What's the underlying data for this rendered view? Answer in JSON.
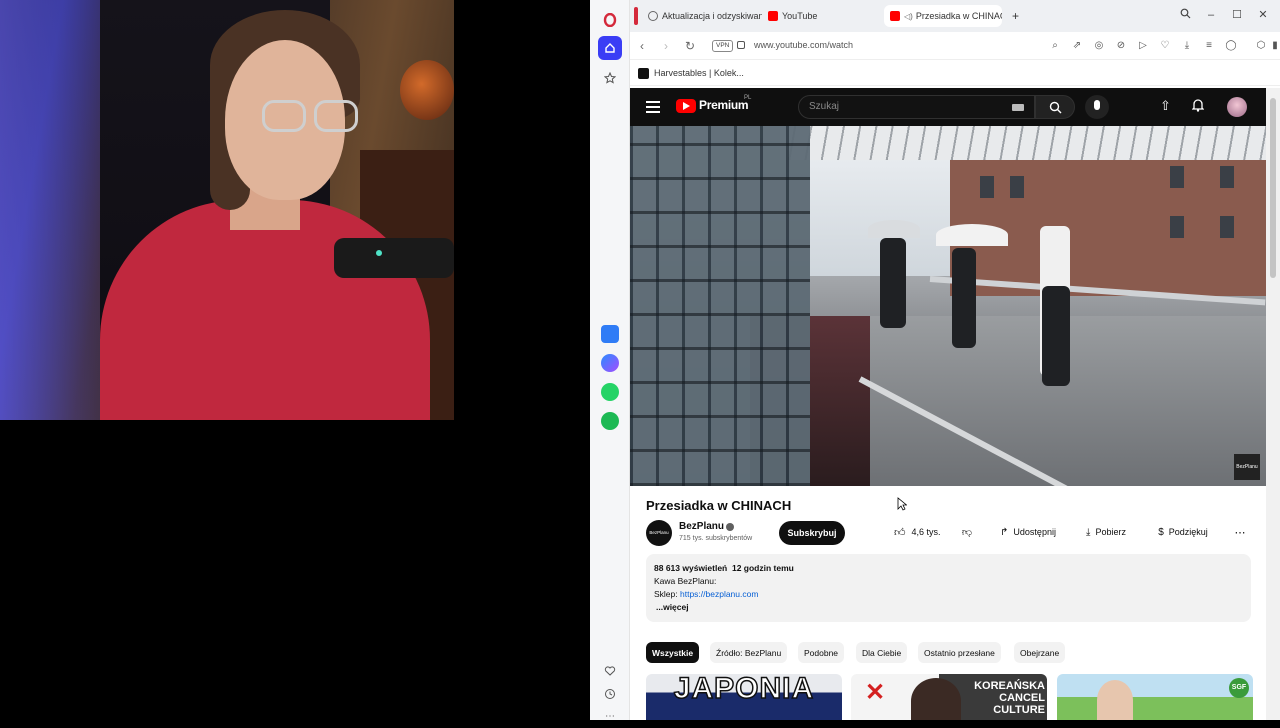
{
  "browser": {
    "tabs": [
      {
        "label": "Aktualizacja i odzyskiwanie",
        "favicon": "opera-update-icon"
      },
      {
        "label": "YouTube",
        "favicon": "youtube-icon"
      },
      {
        "label": "Przesiadka w CHINACH",
        "favicon": "youtube-icon"
      }
    ],
    "new_tab_label": "+",
    "address": "www.youtube.com/watch",
    "vpn_label": "VPN",
    "bookmark": "Harvestables | Kolek..."
  },
  "youtube": {
    "logo_text": "Premium",
    "premium_region": "PL",
    "search_placeholder": "Szukaj",
    "video_watermark": "BezPlanu",
    "title": "Przesiadka w CHINACH",
    "channel": {
      "name": "BezPlanu",
      "avatar_text": "BezPlanu",
      "subscribers": "715 tys. subskrybentów",
      "subscribe_label": "Subskrybuj"
    },
    "actions": {
      "likes": "4,6 tys.",
      "share": "Udostępnij",
      "download": "Pobierz",
      "thanks": "Podziękuj",
      "more": "⋯"
    },
    "description": {
      "views": "88 613 wyświetleń",
      "age": "12 godzin temu",
      "line1": "Kawa BezPlanu:",
      "shop_label": "Sklep:",
      "shop_link": "https://bezplanu.com",
      "more": "...więcej"
    },
    "chips": [
      "Wszystkie",
      "Źródło: BezPlanu",
      "Podobne",
      "Dla Ciebie",
      "Ostatnio przesłane",
      "Obejrzane"
    ],
    "recommendations": [
      {
        "title_overlay": "JAPONIA",
        "bg": "#1a2b6a",
        "fg": "#ffffff"
      },
      {
        "title_overlay": "KOREAŃSKA CANCEL CULTURE",
        "bg": "#3a3a3a",
        "fg": "#ffffff"
      },
      {
        "title_overlay": "SGF",
        "bg": "#7cc05b",
        "fg": "#ffffff"
      }
    ]
  },
  "colors": {
    "yt_red": "#ff0000",
    "opera_red": "#d4293b",
    "opera_blue": "#3a3df5"
  }
}
